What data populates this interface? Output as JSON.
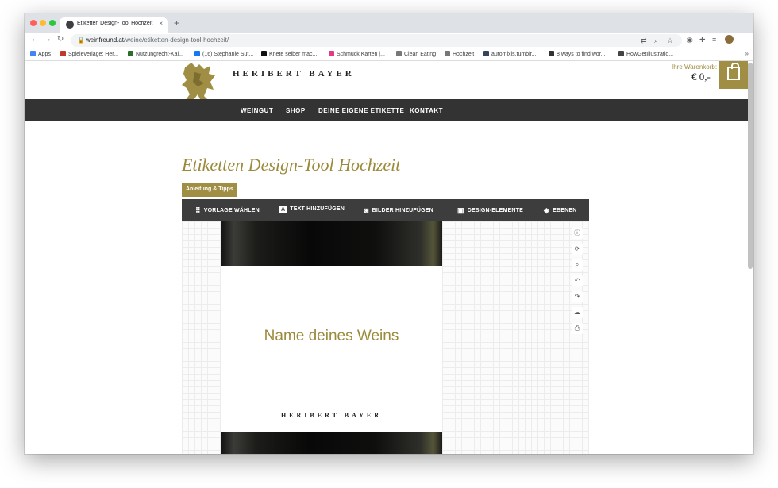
{
  "browser": {
    "tab_title": "Etiketten Design-Tool Hochzeit",
    "tab_close": "×",
    "new_tab": "+",
    "url_host": "weinfreund.at",
    "url_path": "/weine/etiketten-design-tool-hochzeit/",
    "bookmarks": [
      {
        "label": "Apps",
        "color": "#4285f4"
      },
      {
        "label": "Spieleverlage: Her...",
        "color": "#c0392b"
      },
      {
        "label": "Nutzungrecht-Kal...",
        "color": "#2c6e2c"
      },
      {
        "label": "(16) Stephanie Sut...",
        "color": "#1877f2"
      },
      {
        "label": "Knete selber mac...",
        "color": "#111111"
      },
      {
        "label": "Schmuck Karten |...",
        "color": "#e23a86"
      },
      {
        "label": "Clean Eating",
        "color": "#777777"
      },
      {
        "label": "Hochzeit",
        "color": "#777777"
      },
      {
        "label": "automixis.tumblr....",
        "color": "#35465c"
      },
      {
        "label": "8 ways to find wor...",
        "color": "#333333"
      },
      {
        "label": "HowGetIllustratio...",
        "color": "#444444"
      }
    ],
    "bookmarks_more": "»"
  },
  "site": {
    "brand": "HERIBERT BAYER",
    "cart_label": "Ihre Warenkorb:",
    "cart_amount": "€ 0,-",
    "nav": [
      "WEINGUT",
      "SHOP",
      "DEINE EIGENE ETIKETTE",
      "KONTAKT"
    ],
    "title": "Etiketten Design-Tool Hochzeit",
    "tips_button": "Anleitung & Tipps"
  },
  "designer": {
    "toolbar": [
      {
        "label": "VORLAGE WÄHLEN",
        "icon": "grid-icon",
        "glyph": "⠿"
      },
      {
        "label": "TEXT HINZUFÜGEN",
        "icon": "text-icon",
        "glyph": "🅰"
      },
      {
        "label": "BILDER HINZUFÜGEN",
        "icon": "camera-icon",
        "glyph": "◙"
      },
      {
        "label": "DESIGN-ELEMENTE",
        "icon": "image-icon",
        "glyph": "▣"
      },
      {
        "label": "EBENEN",
        "icon": "layers-icon",
        "glyph": "◈"
      }
    ],
    "label_wine_name": "Name deines Weins",
    "label_brand": "HERIBERT BAYER",
    "side_tools": [
      {
        "icon": "info-icon",
        "glyph": "ⓘ"
      },
      {
        "icon": "reset-icon",
        "glyph": "⟳"
      },
      {
        "icon": "zoom-icon",
        "glyph": "⌕"
      },
      {
        "icon": "undo-icon",
        "glyph": "↶"
      },
      {
        "icon": "redo-icon",
        "glyph": "↷"
      },
      {
        "icon": "save-cloud-icon",
        "glyph": "☁"
      },
      {
        "icon": "print-icon",
        "glyph": "⎙"
      }
    ]
  }
}
